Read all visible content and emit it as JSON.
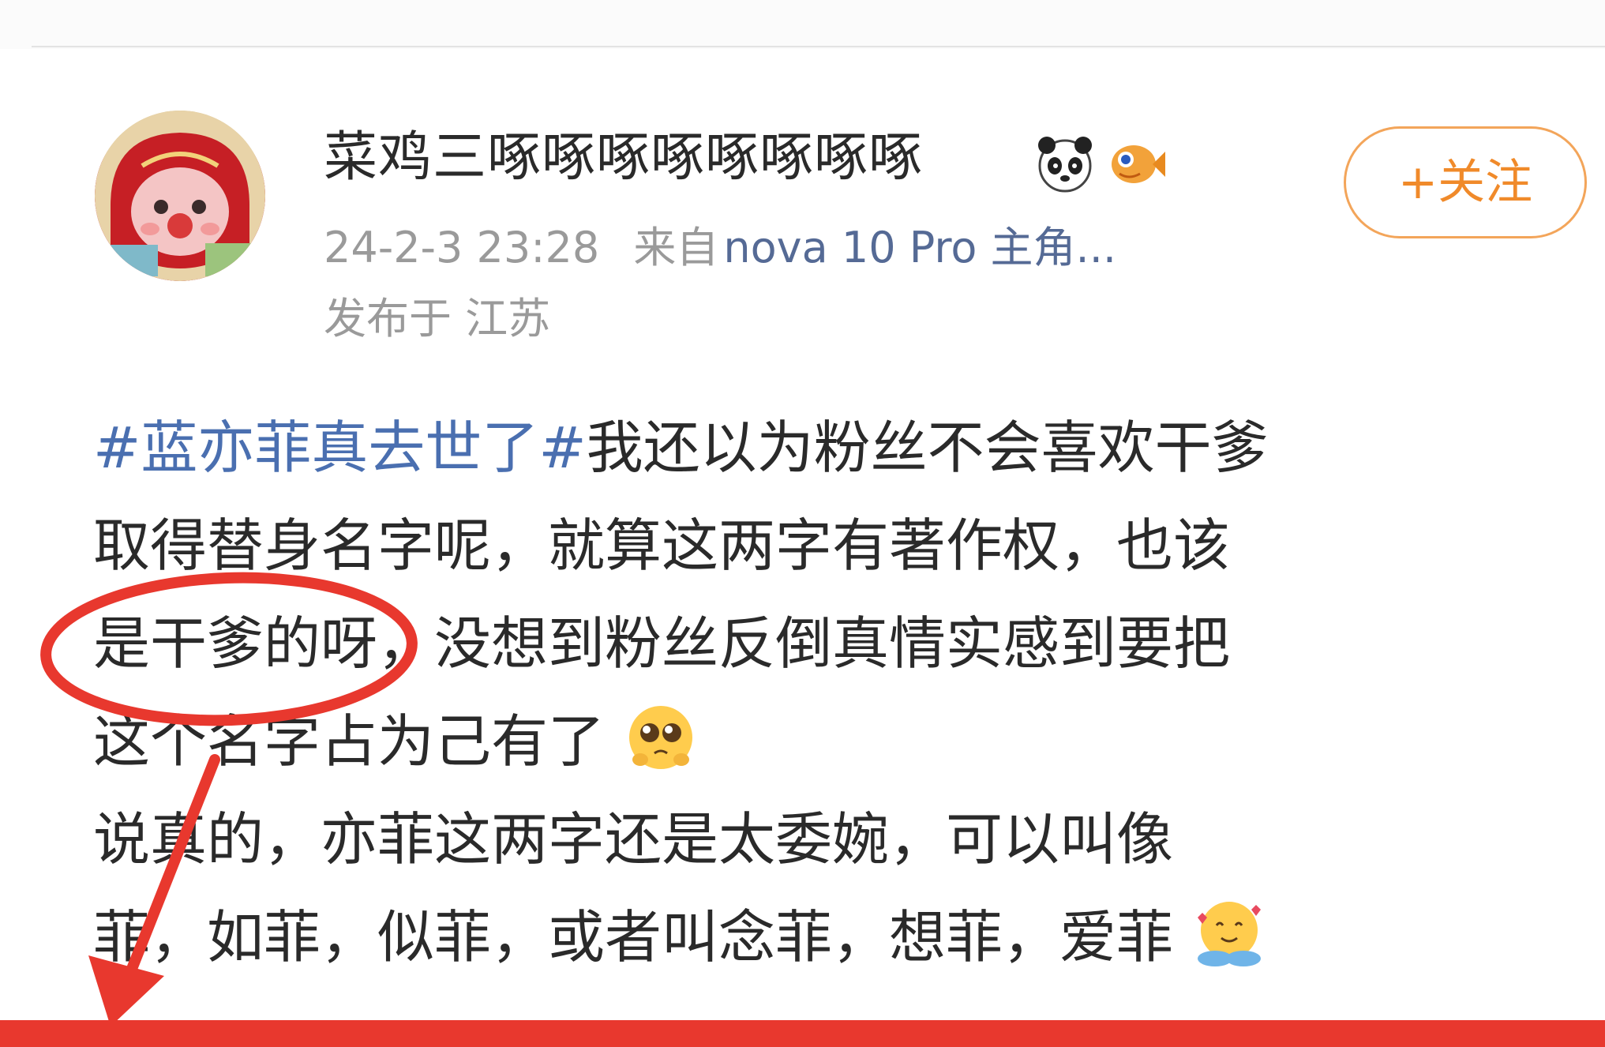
{
  "user": {
    "name": "菜鸡三啄啄啄啄啄啄啄啄",
    "avatar_icon": "avatar-icon",
    "badges": [
      "panda-icon",
      "fish-icon"
    ]
  },
  "post": {
    "date": "24-2-3 23:28",
    "source_prefix": "来自",
    "source": "nova 10 Pro 主角...",
    "location": "发布于 江苏",
    "follow_label": "+关注",
    "lines": [
      {
        "hashtag": "#蓝亦菲真去世了#",
        "text": "我还以为粉丝不会喜欢干爹"
      },
      {
        "text": "取得替身名字呢，就算这两字有著作权，也该"
      },
      {
        "text": "是干爹的呀，没想到粉丝反倒真情实感到要把"
      },
      {
        "text": "这个名字占为己有了"
      },
      {
        "text": "说真的，亦菲这两字还是太委婉，可以叫像"
      },
      {
        "text": "菲，如菲，似菲，或者叫念菲，想菲，爱菲"
      }
    ]
  },
  "colors": {
    "hashtag": "#4a6fb0",
    "follow": "#f08a2a",
    "annotation": "#e8382e"
  }
}
